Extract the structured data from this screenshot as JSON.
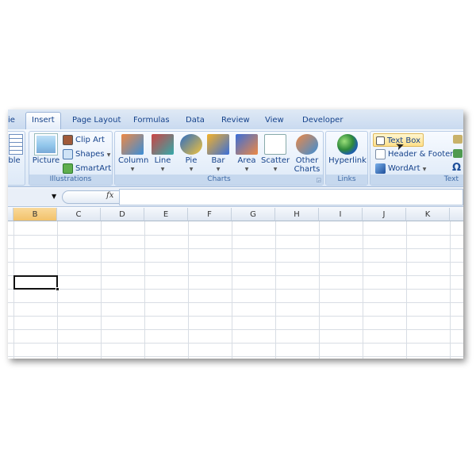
{
  "tabs": [
    {
      "label": "ie"
    },
    {
      "label": "Insert",
      "active": true
    },
    {
      "label": "Page Layout"
    },
    {
      "label": "Formulas"
    },
    {
      "label": "Data"
    },
    {
      "label": "Review"
    },
    {
      "label": "View"
    },
    {
      "label": "Developer"
    }
  ],
  "ribbon": {
    "tables": {
      "label": "ble"
    },
    "illustrations": {
      "group": "Illustrations",
      "picture": "Picture",
      "clip_art": "Clip Art",
      "shapes": "Shapes",
      "smartart": "SmartArt"
    },
    "charts": {
      "group": "Charts",
      "items": [
        "Column",
        "Line",
        "Pie",
        "Bar",
        "Area",
        "Scatter",
        "Other Charts"
      ]
    },
    "links": {
      "group": "Links",
      "hyperlink": "Hyperlink"
    },
    "text": {
      "group": "Text",
      "text_box": "Text Box",
      "header_footer": "Header & Footer",
      "wordart": "WordArt",
      "symbol": "Ω"
    }
  },
  "formula_bar": {
    "fx": "fx",
    "value": ""
  },
  "columns": [
    "B",
    "C",
    "D",
    "E",
    "F",
    "G",
    "H",
    "I",
    "J",
    "K"
  ],
  "selected_column": "B",
  "colors": {
    "accent": "#15428b",
    "selected_header": "#f2c26a",
    "ribbon": "#dce8f6"
  }
}
